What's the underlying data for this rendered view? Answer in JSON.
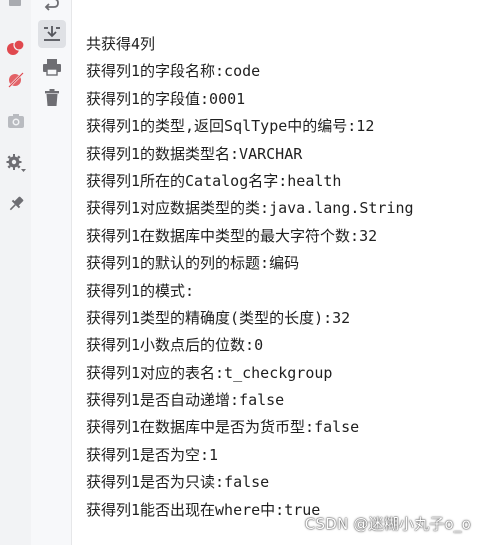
{
  "console": {
    "lines": [
      "共获得4列",
      "获得列1的字段名称:code",
      "获得列1的字段值:0001",
      "获得列1的类型,返回SqlType中的编号:12",
      "获得列1的数据类型名:VARCHAR",
      "获得列1所在的Catalog名字:health",
      "获得列1对应数据类型的类:java.lang.String",
      "获得列1在数据库中类型的最大字符个数:32",
      "获得列1的默认的列的标题:编码",
      "获得列1的模式:",
      "获得列1类型的精确度(类型的长度):32",
      "获得列1小数点后的位数:0",
      "获得列1对应的表名:t_checkgroup",
      "获得列1是否自动递增:false",
      "获得列1在数据库中是否为货币型:false",
      "获得列1是否为空:1",
      "获得列1是否为只读:false",
      "获得列1能否出现在where中:true"
    ]
  },
  "watermark": "CSDN @迷糊小丸子o_o",
  "icons": {
    "left_gutter": [
      "stop-icon",
      "breakpoints-icon",
      "mute-breakpoints-icon",
      "camera-icon",
      "settings-icon",
      "pin-icon"
    ],
    "tool_gutter": [
      "soft-wrap-icon",
      "scroll-to-end-icon",
      "print-icon",
      "trash-icon"
    ]
  },
  "colors": {
    "accent_red": "#e0484e",
    "icon_gray": "#6e6e73"
  }
}
